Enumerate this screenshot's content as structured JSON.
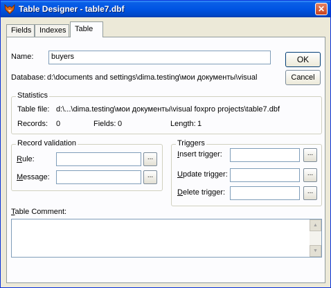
{
  "window": {
    "title": "Table Designer - table7.dbf",
    "close_glyph": "✕"
  },
  "tabs": [
    {
      "label": "Fields"
    },
    {
      "label": "Indexes"
    },
    {
      "label": "Table"
    }
  ],
  "name": {
    "label": "Name:",
    "value": "buyers"
  },
  "buttons": {
    "ok": "OK",
    "cancel": "Cancel",
    "ellipsis": "..."
  },
  "database": {
    "label": "Database:",
    "value": "d:\\documents and settings\\dima.testing\\мои документы\\visual"
  },
  "statistics": {
    "title": "Statistics",
    "table_file_label": "Table file:",
    "table_file_value": "d:\\...\\dima.testing\\мои документы\\visual foxpro projects\\table7.dbf",
    "records_label": "Records:",
    "records_value": "0",
    "fields_label": "Fields:",
    "fields_value": "0",
    "length_label": "Length:",
    "length_value": "1"
  },
  "record_validation": {
    "title": "Record validation",
    "rule_mnemonic": "R",
    "rule_rest": "ule:",
    "rule_value": "",
    "message_mnemonic": "M",
    "message_rest": "essage:",
    "message_value": ""
  },
  "triggers": {
    "title": "Triggers",
    "insert_mnemonic": "I",
    "insert_rest": "nsert trigger:",
    "insert_value": "",
    "update_mnemonic": "U",
    "update_rest": "pdate trigger:",
    "update_value": "",
    "delete_mnemonic": "D",
    "delete_rest": "elete trigger:",
    "delete_value": ""
  },
  "comment": {
    "mnemonic": "T",
    "rest": "able Comment:",
    "value": ""
  }
}
